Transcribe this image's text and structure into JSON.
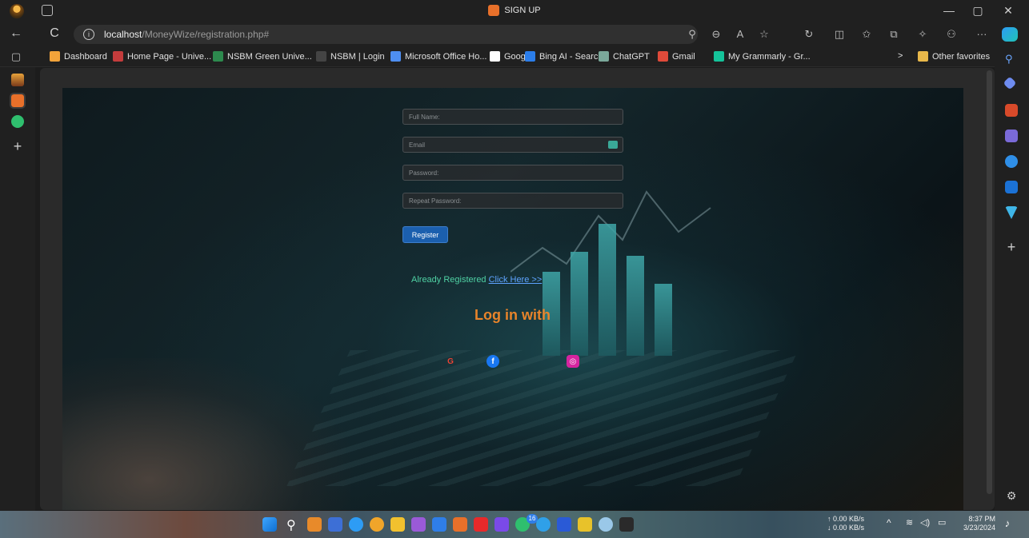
{
  "window": {
    "title": "SIGN UP",
    "minimize": "—",
    "restore": "▢",
    "close": "✕"
  },
  "address": {
    "back": "←",
    "refresh": "C",
    "info": "i",
    "host": "localhost",
    "path": "/MoneyWize/registration.php#",
    "more": "···"
  },
  "favorites": {
    "items": [
      {
        "label": "Dashboard",
        "color": "#f2a33a"
      },
      {
        "label": "Home Page - Unive...",
        "color": "#c43c3c"
      },
      {
        "label": "NSBM Green Unive...",
        "color": "#2d8a4e"
      },
      {
        "label": "NSBM | Login",
        "color": "#444444"
      },
      {
        "label": "Microsoft Office Ho...",
        "color": "#4e8ef0"
      },
      {
        "label": "Google",
        "color": "#ffffff"
      },
      {
        "label": "Bing AI - Search",
        "color": "#2b7de9"
      },
      {
        "label": "ChatGPT",
        "color": "#7aa89a"
      },
      {
        "label": "Gmail",
        "color": "#e04a3a"
      },
      {
        "label": "My Grammarly - Gr...",
        "color": "#15c39a"
      }
    ],
    "overflow": ">",
    "other": "Other favorites"
  },
  "form": {
    "fullname_placeholder": "Full Name:",
    "email_placeholder": "Email",
    "password_placeholder": "Password:",
    "repeat_placeholder": "Repeat Password:",
    "register_label": "Register",
    "already_text": "Already Registered ",
    "click_here": "Click Here >>",
    "login_with": "Log in with"
  },
  "social": [
    {
      "name": "google",
      "glyph": "G",
      "color": "#ea4335"
    },
    {
      "name": "facebook",
      "glyph": "f",
      "color": "#1877f2"
    },
    {
      "name": "instagram",
      "glyph": "◎",
      "color": "#d6249f"
    }
  ],
  "tray": {
    "upload": "↑ 0.00 KB/s",
    "download": "↓ 0.00 KB/s",
    "time": "8:37 PM",
    "date": "3/23/2024",
    "badge": "16"
  },
  "colors": {
    "accent_orange": "#e8842a",
    "link_blue": "#5ea3ff",
    "green_text": "#4fd1a4",
    "button_blue": "#1b5fae"
  }
}
